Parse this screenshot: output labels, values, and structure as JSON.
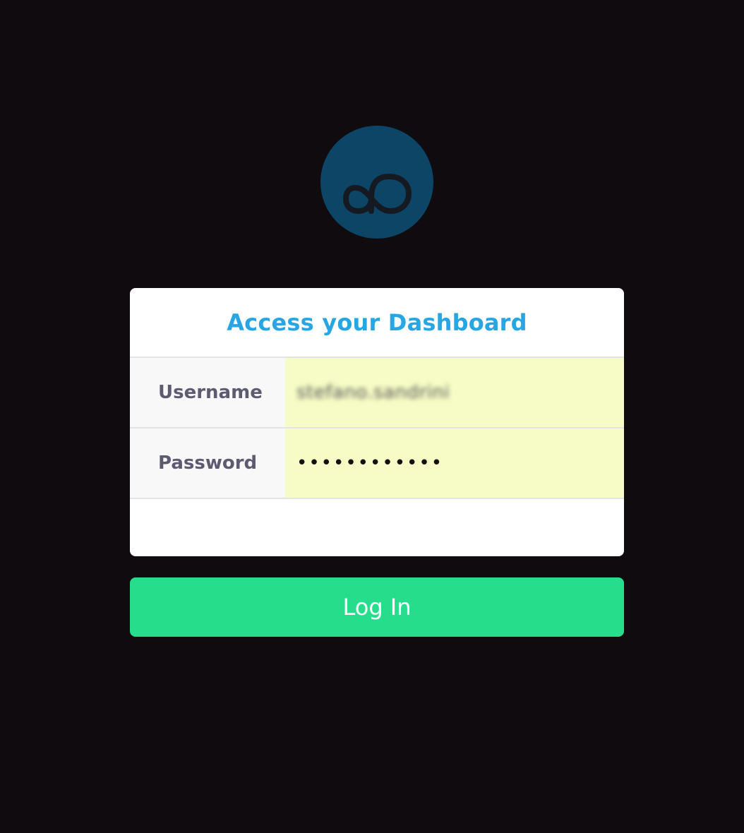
{
  "logo": {
    "icon": "infinity-p-logo-icon",
    "background": "#0d4566",
    "stroke": "#151a22"
  },
  "login_form": {
    "title": "Access your Dashboard",
    "title_color": "#27a6e3",
    "username": {
      "label": "Username",
      "value": "stefano.sandrini"
    },
    "password": {
      "label": "Password",
      "value": "••••••••••••"
    },
    "field_background": "#f7fcc6"
  },
  "login_button": {
    "label": "Log In",
    "color": "#26dd8c"
  }
}
